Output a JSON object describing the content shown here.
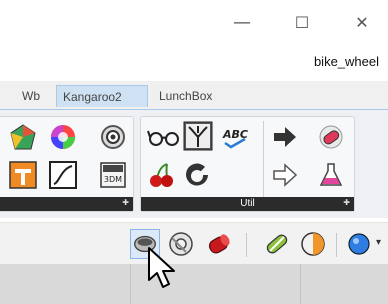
{
  "window": {
    "min_glyph": "—",
    "max_glyph": "☐",
    "close_glyph": "✕",
    "document_title": "bike_wheel"
  },
  "tabs": [
    {
      "label": "Wb"
    },
    {
      "label": "Kangaroo2",
      "active": true
    },
    {
      "label": "LunchBox"
    }
  ],
  "ribbon": {
    "util_panel_label": "Util",
    "expand_glyph": "✚"
  },
  "colors": {
    "active_tab": "#cfe2f3",
    "panel_footer": "#2b2b2b",
    "selected_tool": "#dceaf8"
  }
}
